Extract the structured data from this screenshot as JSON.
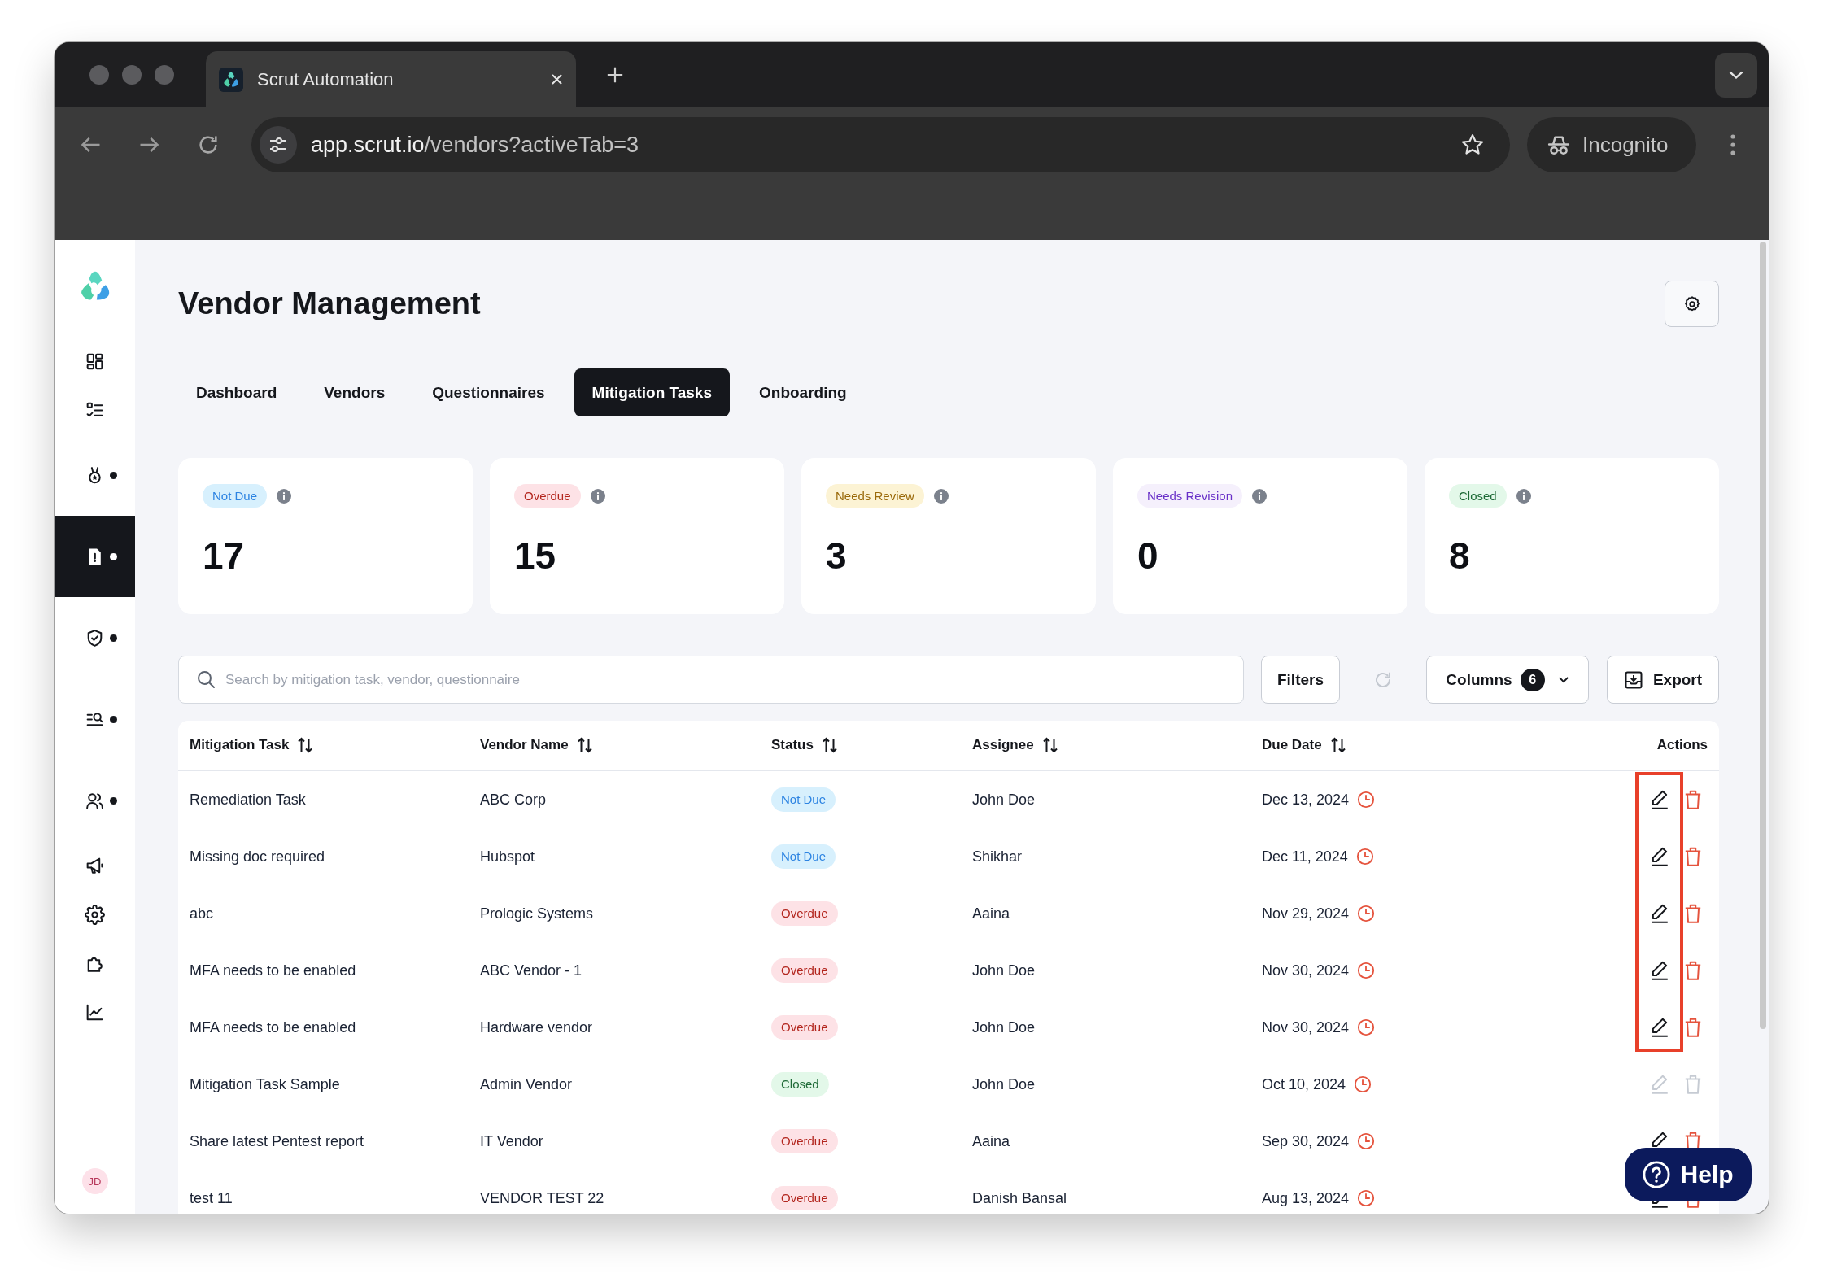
{
  "browser": {
    "tab_title": "Scrut Automation",
    "address_host": "app.scrut.io",
    "address_path": "/vendors?activeTab=3",
    "profile_label": "Incognito"
  },
  "sidebar": {
    "items": [
      {
        "selected": false,
        "dot": false
      },
      {
        "selected": false,
        "dot": false
      },
      {
        "selected": false,
        "dot": true
      },
      {
        "selected": true,
        "dot": true
      },
      {
        "selected": false,
        "dot": true
      },
      {
        "selected": false,
        "dot": true
      },
      {
        "selected": false,
        "dot": true
      },
      {
        "selected": false,
        "dot": false
      },
      {
        "selected": false,
        "dot": false
      },
      {
        "selected": false,
        "dot": false
      },
      {
        "selected": false,
        "dot": false
      }
    ],
    "avatar": "JD"
  },
  "page": {
    "title": "Vendor Management"
  },
  "tabs": [
    {
      "label": "Dashboard",
      "selected": false
    },
    {
      "label": "Vendors",
      "selected": false
    },
    {
      "label": "Questionnaires",
      "selected": false
    },
    {
      "label": "Mitigation Tasks",
      "selected": true
    },
    {
      "label": "Onboarding",
      "selected": false
    }
  ],
  "summary_cards": [
    {
      "label": "Not Due",
      "kind": "not_due",
      "count": "17"
    },
    {
      "label": "Overdue",
      "kind": "overdue",
      "count": "15"
    },
    {
      "label": "Needs Review",
      "kind": "needs_review",
      "count": "3"
    },
    {
      "label": "Needs Revision",
      "kind": "needs_revision",
      "count": "0"
    },
    {
      "label": "Closed",
      "kind": "closed",
      "count": "8"
    }
  ],
  "toolbar": {
    "search": {
      "placeholder": "Search by mitigation task, vendor, questionnaire"
    },
    "filters_label": "Filters",
    "columns_label": "Columns",
    "columns_count": "6",
    "export_label": "Export"
  },
  "table": {
    "columns": [
      {
        "label": "Mitigation Task",
        "sortable": true
      },
      {
        "label": "Vendor Name",
        "sortable": true
      },
      {
        "label": "Status",
        "sortable": true
      },
      {
        "label": "Assignee",
        "sortable": true
      },
      {
        "label": "Due Date",
        "sortable": true
      },
      {
        "label": "Actions",
        "sortable": false
      }
    ],
    "rows": [
      {
        "task": "Remediation Task",
        "vendor": "ABC Corp",
        "status": {
          "label": "Not Due",
          "kind": "not_due"
        },
        "assignee": "John Doe",
        "due_date": "Dec 13, 2024",
        "actions_disabled": false,
        "highlighted": true
      },
      {
        "task": "Missing doc required",
        "vendor": "Hubspot",
        "status": {
          "label": "Not Due",
          "kind": "not_due"
        },
        "assignee": "Shikhar",
        "due_date": "Dec 11, 2024",
        "actions_disabled": false,
        "highlighted": true
      },
      {
        "task": "abc",
        "vendor": "Prologic Systems",
        "status": {
          "label": "Overdue",
          "kind": "overdue"
        },
        "assignee": "Aaina",
        "due_date": "Nov 29, 2024",
        "actions_disabled": false,
        "highlighted": true
      },
      {
        "task": "MFA needs to be enabled",
        "vendor": "ABC Vendor - 1",
        "status": {
          "label": "Overdue",
          "kind": "overdue"
        },
        "assignee": "John Doe",
        "due_date": "Nov 30, 2024",
        "actions_disabled": false,
        "highlighted": true
      },
      {
        "task": "MFA needs to be enabled",
        "vendor": "Hardware vendor",
        "status": {
          "label": "Overdue",
          "kind": "overdue"
        },
        "assignee": "John Doe",
        "due_date": "Nov 30, 2024",
        "actions_disabled": false,
        "highlighted": true
      },
      {
        "task": "Mitigation Task Sample",
        "vendor": "Admin Vendor",
        "status": {
          "label": "Closed",
          "kind": "closed"
        },
        "assignee": "John Doe",
        "due_date": "Oct 10, 2024",
        "actions_disabled": true,
        "highlighted": false
      },
      {
        "task": "Share latest Pentest report",
        "vendor": "IT Vendor",
        "status": {
          "label": "Overdue",
          "kind": "overdue"
        },
        "assignee": "Aaina",
        "due_date": "Sep 30, 2024",
        "actions_disabled": false,
        "highlighted": false
      },
      {
        "task": "test 11",
        "vendor": "VENDOR TEST 22",
        "status": {
          "label": "Overdue",
          "kind": "overdue"
        },
        "assignee": "Danish Bansal",
        "due_date": "Aug 13, 2024",
        "actions_disabled": false,
        "highlighted": false
      }
    ]
  },
  "help_button": {
    "label": "Help"
  }
}
